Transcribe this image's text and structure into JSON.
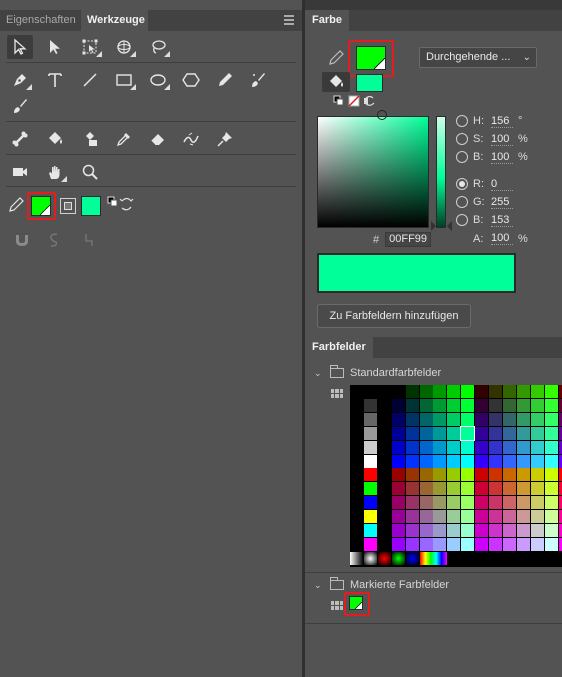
{
  "left_panel": {
    "tabs": [
      {
        "label": "Eigenschaften",
        "active": false
      },
      {
        "label": "Werkzeuge",
        "active": true
      }
    ],
    "tool_rows": [
      [
        "selection-tool",
        "subselection-tool",
        "free-transform-tool",
        "3d-rotation-tool",
        "lasso-tool"
      ],
      [
        "pen-tool",
        "text-tool",
        "line-tool",
        "rectangle-tool",
        "oval-tool",
        "polystar-tool",
        "pencil-tool",
        "paint-brush-tool"
      ],
      [
        "brush-tool"
      ],
      [
        "bone-tool",
        "paint-bucket-tool",
        "ink-bottle-tool",
        "eyedropper-tool",
        "eraser-tool",
        "width-tool",
        "asset-warp-pin-tool"
      ],
      [
        "camera-tool",
        "hand-tool",
        "zoom-tool"
      ]
    ],
    "stroke_color": "#00FF00",
    "fill_color": "#00FF99",
    "snap_tools": [
      "snap-to-objects-icon",
      "smooth-icon",
      "straighten-icon"
    ]
  },
  "color_panel": {
    "tab_label": "Farbe",
    "stroke_color": "#00FF00",
    "fill_color": "#00FF99",
    "fill_type": "Durchgehende ...",
    "hsb": [
      {
        "label": "H:",
        "value": "156",
        "unit": "°",
        "selected": false
      },
      {
        "label": "S:",
        "value": "100",
        "unit": "%",
        "selected": false
      },
      {
        "label": "B:",
        "value": "100",
        "unit": "%",
        "selected": false
      }
    ],
    "rgb": [
      {
        "label": "R:",
        "value": "0",
        "unit": "",
        "selected": true
      },
      {
        "label": "G:",
        "value": "255",
        "unit": "",
        "selected": false
      },
      {
        "label": "B:",
        "value": "153",
        "unit": "",
        "selected": false
      }
    ],
    "hex_prefix": "#",
    "hex_value": "00FF99",
    "alpha_label": "A:",
    "alpha_value": "100",
    "alpha_unit": "%",
    "add_button_label": "Zu Farbfeldern hinzufügen"
  },
  "swatches_panel": {
    "tab_label": "Farbfelder",
    "groups": [
      {
        "label": "Standardfarbfelder"
      },
      {
        "label": "Markierte Farbfelder"
      }
    ],
    "marked_swatch_color": "#00FF00",
    "selected_swatch_color": "#00FF99",
    "accent_highlight": "#e01e1e"
  }
}
